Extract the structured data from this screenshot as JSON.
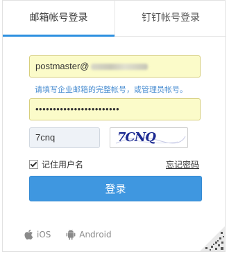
{
  "tabs": {
    "mailbox_login": "邮箱帐号登录",
    "dingtalk_login": "钉钉帐号登录"
  },
  "form": {
    "email_prefix": "postmaster@",
    "email_hint": "请填写企业邮箱的完整帐号，或管理员帐号。",
    "password_dots": "••••••••••••••••••••••••",
    "captcha_value": "7cnq",
    "captcha_image_text": "7CNQ",
    "remember_label": "记住用户名",
    "forgot_label": "忘记密码",
    "login_label": "登录"
  },
  "apps": {
    "ios": "iOS",
    "android": "Android"
  },
  "icons": [
    "apple-icon",
    "android-icon",
    "qr-code-icon",
    "checkbox-checked"
  ],
  "colors": {
    "accent": "#3f97e0",
    "hint": "#4a8ed1",
    "autofill_bg": "#fbfbc9"
  }
}
